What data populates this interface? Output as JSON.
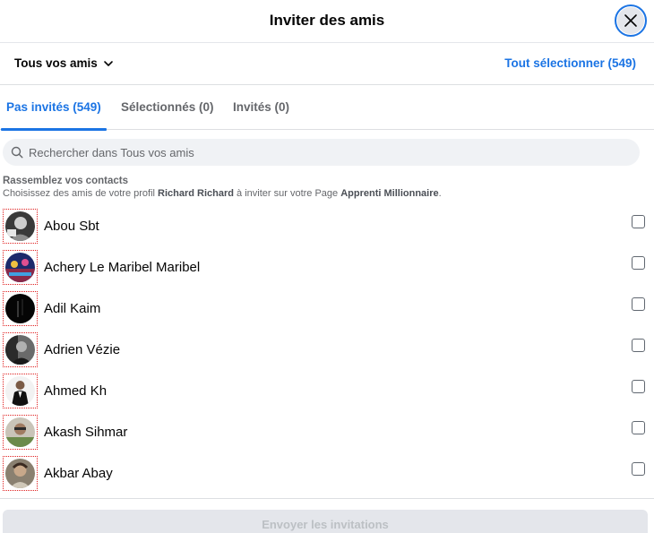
{
  "dialog": {
    "title": "Inviter des amis",
    "close_icon": "close-icon"
  },
  "filter": {
    "dropdown_label": "Tous vos amis",
    "dropdown_icon": "chevron-down-icon",
    "select_all_label": "Tout sélectionner (549)"
  },
  "tabs": [
    {
      "label": "Pas invités (549)",
      "active": true
    },
    {
      "label": "Sélectionnés (0)",
      "active": false
    },
    {
      "label": "Invités (0)",
      "active": false
    }
  ],
  "search": {
    "placeholder": "Rechercher dans Tous vos amis",
    "value": "",
    "icon": "search-icon"
  },
  "info": {
    "title": "Rassemblez vos contacts",
    "text_before": "Choisissez des amis de votre profil ",
    "profile_name": "Richard Richard",
    "text_middle": " à inviter sur votre Page ",
    "page_name": "Apprenti Millionnaire",
    "text_after": "."
  },
  "friends": [
    {
      "name": "Abou Sbt",
      "checked": false
    },
    {
      "name": "Achery Le Maribel Maribel",
      "checked": false
    },
    {
      "name": "Adil Kaim",
      "checked": false
    },
    {
      "name": "Adrien Vézie",
      "checked": false
    },
    {
      "name": "Ahmed Kh",
      "checked": false
    },
    {
      "name": "Akash Sihmar",
      "checked": false
    },
    {
      "name": "Akbar Abay",
      "checked": false
    }
  ],
  "footer": {
    "send_label": "Envoyer les invitations",
    "send_disabled": true
  },
  "colors": {
    "accent": "#1b74e4",
    "secondary_text": "#65676b",
    "disabled_bg": "#e4e6eb",
    "disabled_text": "#bcc0c4"
  }
}
